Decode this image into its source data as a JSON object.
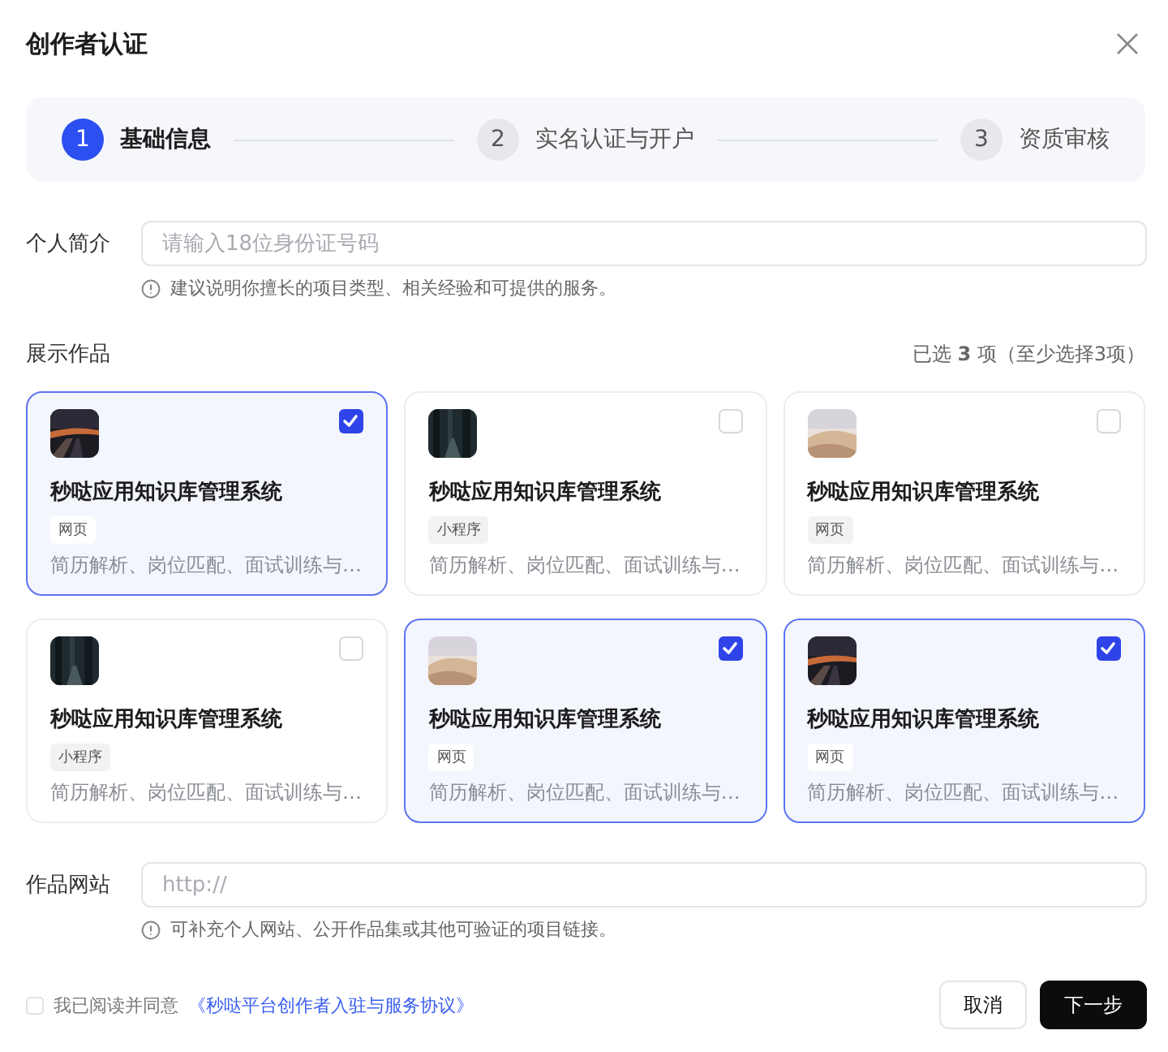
{
  "dialog": {
    "title": "创作者认证"
  },
  "steps": [
    {
      "number": "1",
      "label": "基础信息",
      "selected": true
    },
    {
      "number": "2",
      "label": "实名认证与开户",
      "selected": false
    },
    {
      "number": "3",
      "label": "资质审核",
      "selected": false
    }
  ],
  "bio": {
    "label": "个人简介",
    "placeholder": "请输入18位身份证号码",
    "hint": "建议说明你擅长的项目类型、相关经验和可提供的服务。"
  },
  "works": {
    "label": "展示作品",
    "count": "已选 **3** 项（至少选择3项）",
    "items": [
      {
        "title": "秒哒应用知识库管理系统",
        "tag": "网页",
        "description": "简历解析、岗位匹配、面试训练与…",
        "selected": true
      },
      {
        "title": "秒哒应用知识库管理系统",
        "tag": "小程序",
        "description": "简历解析、岗位匹配、面试训练与…",
        "selected": false
      },
      {
        "title": "秒哒应用知识库管理系统",
        "tag": "网页",
        "description": "简历解析、岗位匹配、面试训练与…",
        "selected": false
      },
      {
        "title": "秒哒应用知识库管理系统",
        "tag": "小程序",
        "description": "简历解析、岗位匹配、面试训练与…",
        "selected": false
      },
      {
        "title": "秒哒应用知识库管理系统",
        "tag": "网页",
        "description": "简历解析、岗位匹配、面试训练与…",
        "selected": true
      },
      {
        "title": "秒哒应用知识库管理系统",
        "tag": "网页",
        "description": "简历解析、岗位匹配、面试训练与…",
        "selected": true
      }
    ]
  },
  "website": {
    "label": "作品网站",
    "placeholder": "http://",
    "hint": "可补充个人网站、公开作品集或其他可验证的项目链接。"
  },
  "agreement": {
    "checked": false,
    "text": "我已阅读并同意",
    "link": "《秒哒平台创作者入驻与服务协议》"
  },
  "buttons": {
    "cancel": "取消",
    "next": "下一步"
  }
}
